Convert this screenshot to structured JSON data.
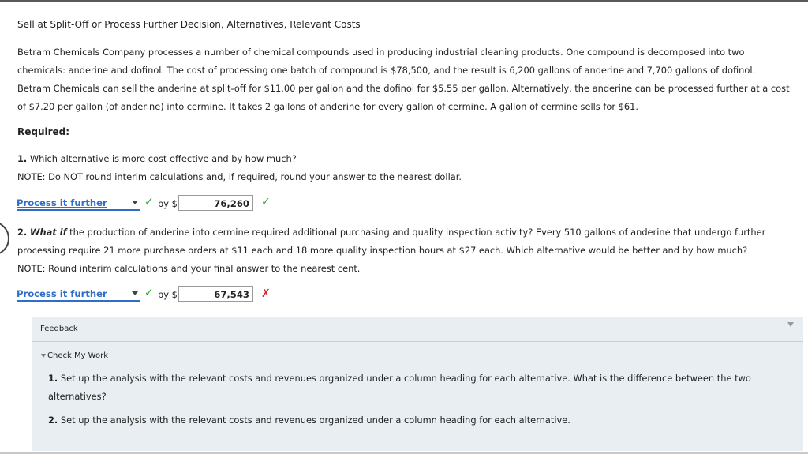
{
  "title": "Sell at Split-Off or Process Further Decision, Alternatives, Relevant Costs",
  "problem": {
    "line1": "Betram Chemicals Company processes a number of chemical compounds used in producing industrial cleaning products. One compound is decomposed into two",
    "line2": "chemicals: anderine and dofinol. The cost of processing one batch of compound is $78,500, and the result is 6,200 gallons of anderine and 7,700 gallons of dofinol.",
    "line3": "Betram Chemicals can sell the anderine at split-off for $11.00 per gallon and the dofinol for $5.55 per gallon. Alternatively, the anderine can be processed further at a cost",
    "line4": "of $7.20 per gallon (of anderine) into cermine. It takes 2 gallons of anderine for every gallon of cermine. A gallon of cermine sells for $61."
  },
  "required_label": "Required:",
  "q1": {
    "number": "1.",
    "text": "Which alternative is more cost effective and by how much?",
    "note": "NOTE: Do NOT round interim calculations and, if required, round your answer to the nearest dollar.",
    "selected": "Process it further",
    "by": "by $",
    "value": "76,260",
    "status": "correct"
  },
  "q2": {
    "number": "2.",
    "whatif": "What if",
    "line1": "the production of anderine into cermine required additional purchasing and quality inspection activity? Every 510 gallons of anderine that undergo further",
    "line2": "processing require 21 more purchase orders at $11 each and 18 more quality inspection hours at $27 each. Which alternative would be better and by how much?",
    "note": "NOTE: Round interim calculations and your final answer to the nearest cent.",
    "selected": "Process it further",
    "by": "by $",
    "value": "67,543",
    "status": "incorrect"
  },
  "feedback": {
    "title": "Feedback",
    "check_my_work": "Check My Work",
    "item1_num": "1.",
    "item1_line1": "Set up the analysis with the relevant costs and revenues organized under a column heading for each alternative. What is the difference between the two",
    "item1_line2": "alternatives?",
    "item2_num": "2.",
    "item2": "Set up the analysis with the relevant costs and revenues organized under a column heading for each alternative."
  },
  "icons": {
    "correct": "checkmark-icon",
    "incorrect": "x-mark-icon",
    "dropdown": "dropdown-arrow-icon",
    "collapse": "collapse-triangle-icon"
  },
  "colors": {
    "link_blue": "#2e6ec9",
    "correct_green": "#2e9e2e",
    "incorrect_red": "#d9262c",
    "feedback_bg": "#e8eef1"
  }
}
